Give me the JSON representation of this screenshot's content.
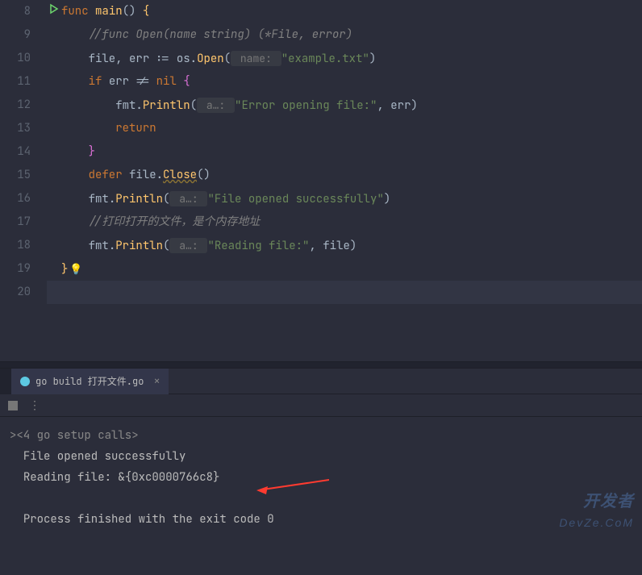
{
  "lineNumbers": [
    "8",
    "9",
    "10",
    "11",
    "12",
    "13",
    "14",
    "15",
    "16",
    "17",
    "18",
    "19",
    "20"
  ],
  "code": {
    "l8": {
      "kw1": "func",
      "fn": "main",
      "parens": "()",
      "brace": "{"
    },
    "l9": {
      "comment": "//func Open(name string) (*File, error)"
    },
    "l10": {
      "ident1": "file",
      "comma": ", ",
      "ident2": "err",
      "op": " := ",
      "pkg": "os",
      "dot": ".",
      "method": "Open",
      "lp": "(",
      "hint": " name: ",
      "str": "\"example.txt\"",
      "rp": ")"
    },
    "l11": {
      "kw": "if",
      "ident": "err",
      "op": " != ",
      "nil": "nil",
      "brace": " {"
    },
    "l12": {
      "pkg": "fmt",
      "dot": ".",
      "method": "Println",
      "lp": "(",
      "hint": " a…: ",
      "str": "\"Error opening file:\"",
      "comma": ", ",
      "ident": "err",
      "rp": ")"
    },
    "l13": {
      "kw": "return"
    },
    "l14": {
      "brace": "}"
    },
    "l15": {
      "kw": "defer",
      "ident": "file",
      "dot": ".",
      "method": "Close",
      "parens": "()"
    },
    "l16": {
      "pkg": "fmt",
      "dot": ".",
      "method": "Println",
      "lp": "(",
      "hint": " a…: ",
      "str": "\"File opened successfully\"",
      "rp": ")"
    },
    "l17": {
      "comment": "//打印打开的文件，是个内存地址"
    },
    "l18": {
      "pkg": "fmt",
      "dot": ".",
      "method": "Println",
      "lp": "(",
      "hint": " a…: ",
      "str": "\"Reading file:\"",
      "comma": ", ",
      "ident": "file",
      "rp": ")"
    },
    "l19": {
      "brace": "}"
    }
  },
  "tab": {
    "label": "go build 打开文件.go"
  },
  "console": {
    "setup": "><4 go setup calls>",
    "line1": "File opened successfully",
    "line2": "Reading file: &{0xc0000766c8}",
    "line3": "Process finished with the exit code 0"
  },
  "watermark": {
    "line1": "开发者",
    "line2": "DevZe.CoM"
  }
}
